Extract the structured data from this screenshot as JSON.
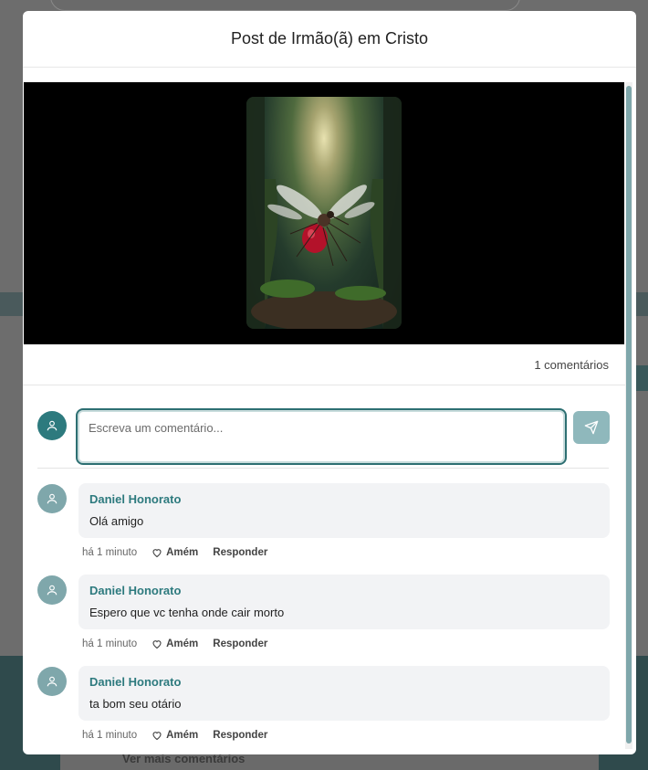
{
  "modal": {
    "title": "Post de Irmão(ã) em Cristo"
  },
  "post": {
    "comments_count_label": "1 comentários"
  },
  "composer": {
    "placeholder": "Escreva um comentário...",
    "value": ""
  },
  "comments": [
    {
      "author": "Daniel Honorato",
      "text": "Olá amigo",
      "time": "há 1 minuto",
      "amen_label": "Amém",
      "reply_label": "Responder"
    },
    {
      "author": "Daniel Honorato",
      "text": "Espero que vc tenha onde cair morto",
      "time": "há 1 minuto",
      "amen_label": "Amém",
      "reply_label": "Responder"
    },
    {
      "author": "Daniel Honorato",
      "text": "ta bom seu otário",
      "time": "há 1 minuto",
      "amen_label": "Amém",
      "reply_label": "Responder"
    }
  ],
  "background": {
    "more_comments_label": "Ver mais comentários"
  },
  "colors": {
    "accent": "#2d7a7e",
    "accent_light": "#8fb8bc",
    "bubble": "#f2f3f5"
  },
  "icons": {
    "avatar": "user-icon",
    "send": "send-icon",
    "amen": "heart-icon"
  }
}
